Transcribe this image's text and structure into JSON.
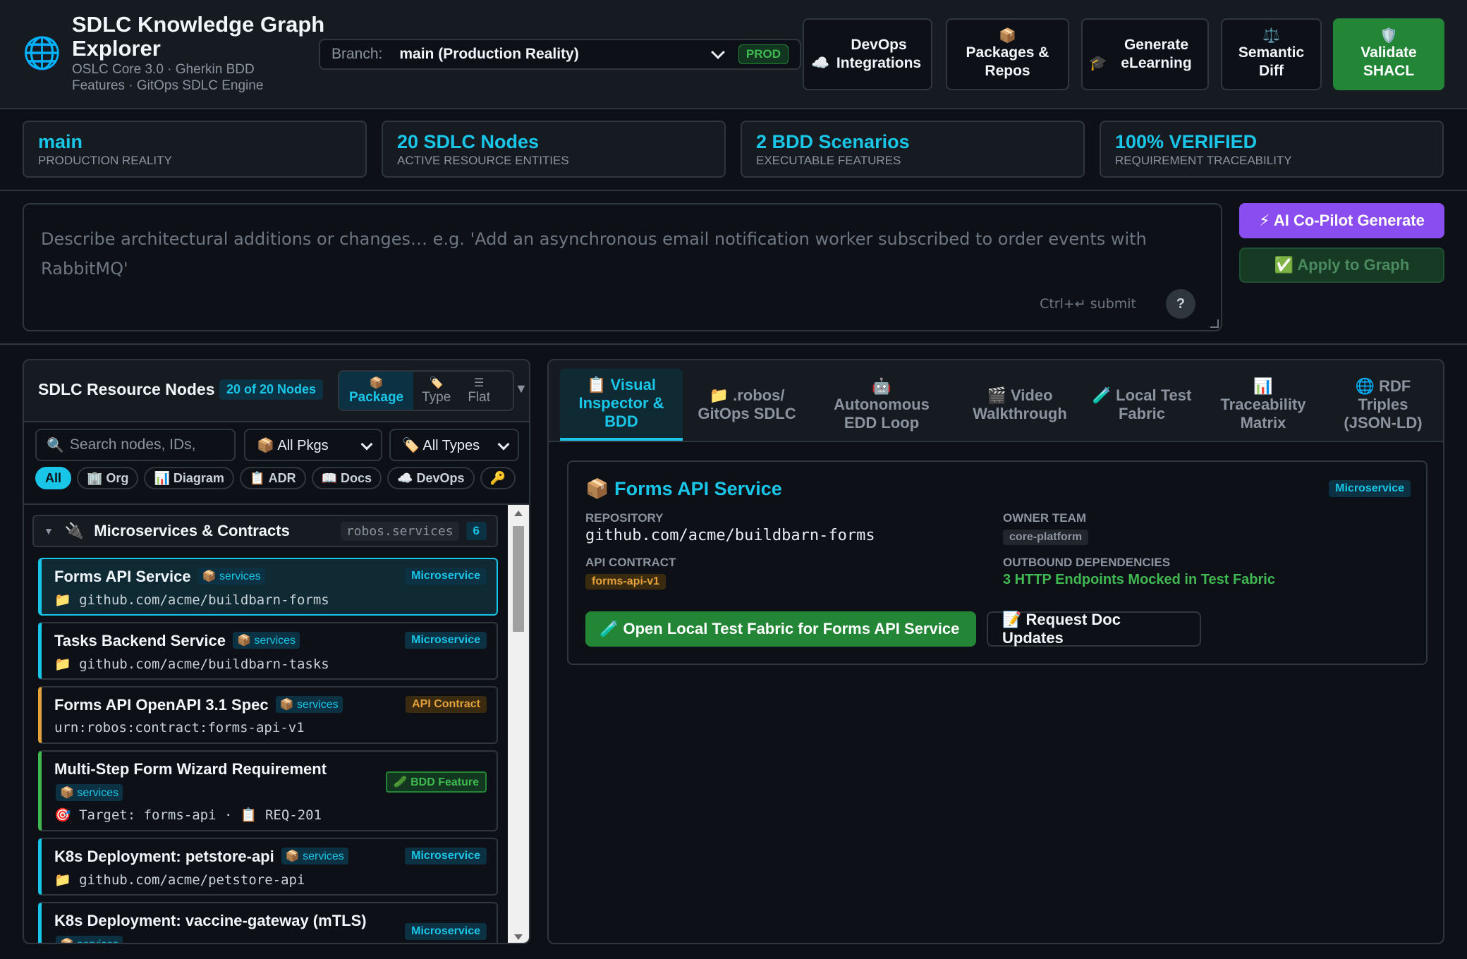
{
  "header": {
    "title": "SDLC Knowledge Graph Explorer",
    "subtitle": "OSLC Core 3.0 · Gherkin BDD Features · GitOps SDLC Engine",
    "branch_label": "Branch:",
    "branch_value": "main (Production Reality)",
    "branch_badge": "PROD",
    "buttons": [
      {
        "icon": "☁️",
        "label": "DevOps Integrations"
      },
      {
        "icon": "📦",
        "label": "Packages & Repos"
      },
      {
        "icon": "🎓",
        "label": "Generate eLearning"
      },
      {
        "icon": "⚖️",
        "label": "Semantic Diff"
      },
      {
        "icon": "🛡️",
        "label": "Validate SHACL"
      }
    ]
  },
  "stats": [
    {
      "value": "main",
      "label": "PRODUCTION REALITY"
    },
    {
      "value": "20 SDLC Nodes",
      "label": "ACTIVE RESOURCE ENTITIES"
    },
    {
      "value": "2 BDD Scenarios",
      "label": "EXECUTABLE FEATURES"
    },
    {
      "value": "100% VERIFIED",
      "label": "REQUIREMENT TRACEABILITY"
    }
  ],
  "prompt": {
    "placeholder": "Describe architectural additions or changes… e.g. 'Add an asynchronous email notification worker subscribed to order events with RabbitMQ'",
    "hint": "Ctrl+↵ submit",
    "help": "?",
    "ai_button": "⚡ AI Co-Pilot Generate",
    "apply_button": "✅ Apply to Graph"
  },
  "left_panel": {
    "title": "SDLC Resource Nodes",
    "count": "20 of 20 Nodes",
    "group_modes": [
      {
        "icon": "📦",
        "label": "Package",
        "active": true
      },
      {
        "icon": "🏷️",
        "label": "Type",
        "active": false
      },
      {
        "icon": "☰",
        "label": "Flat",
        "active": false
      }
    ],
    "caret": "▼",
    "search_placeholder": "Search nodes, IDs,",
    "pkg_filter": "📦 All Pkgs",
    "type_filter": "🏷️ All Types",
    "chips": [
      "All",
      "🏢 Org",
      "📊 Diagram",
      "📋 ADR",
      "📖 Docs",
      "☁️ DevOps",
      "🔑"
    ],
    "group": {
      "icon": "🔌",
      "name": "Microservices & Contracts",
      "namespace": "robos.services",
      "count": "6"
    },
    "items": [
      {
        "name": "Forms API Service",
        "pkg": "📦 services",
        "type": "Microservice",
        "sub": "📁  github.com/acme/buildbarn-forms"
      },
      {
        "name": "Tasks Backend Service",
        "pkg": "📦 services",
        "type": "Microservice",
        "sub": "📁  github.com/acme/buildbarn-tasks"
      },
      {
        "name": "Forms API OpenAPI 3.1 Spec",
        "pkg": "📦 services",
        "type": "API Contract",
        "sub": "urn:robos:contract:forms-api-v1"
      },
      {
        "name": "Multi-Step Form Wizard Requirement",
        "pkg": "📦 services",
        "type": "🥒 BDD Feature",
        "sub": "🎯 Target: forms-api · 📋 REQ-201"
      },
      {
        "name": "K8s Deployment: petstore-api",
        "pkg": "📦 services",
        "type": "Microservice",
        "sub": "📁  github.com/acme/petstore-api"
      },
      {
        "name": "K8s Deployment: vaccine-gateway (mTLS)",
        "pkg": "📦 services",
        "type": "Microservice",
        "sub": ""
      }
    ]
  },
  "right_panel": {
    "tabs": [
      {
        "icon": "📋",
        "label": "Visual Inspector & BDD"
      },
      {
        "icon": "📁",
        "label": ".robos/ GitOps SDLC"
      },
      {
        "icon": "🤖",
        "label": "Autonomous EDD Loop"
      },
      {
        "icon": "🎬",
        "label": "Video Walkthrough"
      },
      {
        "icon": "🧪",
        "label": "Local Test Fabric"
      },
      {
        "icon": "📊",
        "label": "Traceability Matrix"
      },
      {
        "icon": "🌐",
        "label": "RDF Triples (JSON-LD)"
      }
    ],
    "detail": {
      "title": "📦 Forms API Service",
      "badge": "Microservice",
      "repository_label": "REPOSITORY",
      "repository": "github.com/acme/buildbarn-forms",
      "owner_label": "OWNER TEAM",
      "owner": "core-platform",
      "contract_label": "API CONTRACT",
      "contract": "forms-api-v1",
      "deps_label": "OUTBOUND DEPENDENCIES",
      "deps": "3 HTTP Endpoints Mocked in Test Fabric",
      "primary_button": "🧪 Open Local Test Fabric for Forms API Service",
      "secondary_button": "📝 Request Doc Updates"
    }
  },
  "colors": {
    "accent": "#1ac6e8",
    "success": "#238636",
    "ai": "#8a4ef0",
    "contract": "#e3a23b",
    "background": "#0d1117"
  }
}
